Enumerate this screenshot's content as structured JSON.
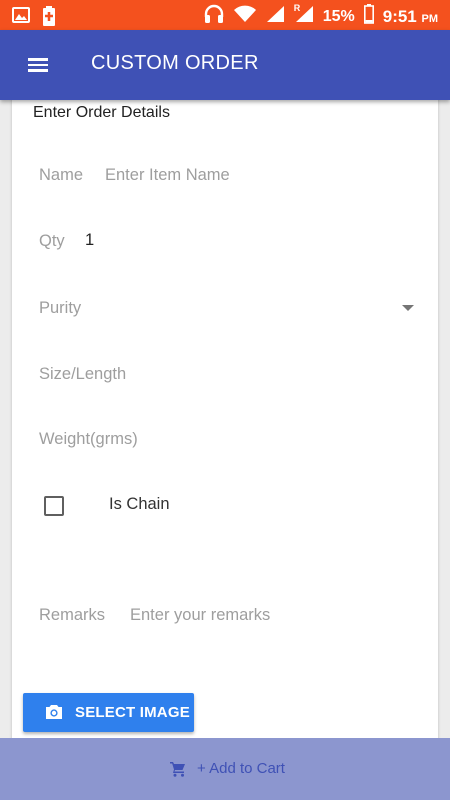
{
  "status_bar": {
    "battery": "15%",
    "time": "9:51",
    "ampm": "PM",
    "network_badge": "R"
  },
  "app_bar": {
    "title": "CUSTOM ORDER"
  },
  "form": {
    "section_title": "Enter Order Details",
    "name_label": "Name",
    "name_placeholder": "Enter Item Name",
    "qty_label": "Qty",
    "qty_value": "1",
    "purity_label": "Purity",
    "size_label": "Size/Length",
    "weight_label": "Weight(grms)",
    "is_chain_label": "Is Chain",
    "is_chain_checked": false,
    "remarks_label": "Remarks",
    "remarks_placeholder": "Enter your remarks"
  },
  "actions": {
    "select_image_label": "SELECT IMAGE",
    "add_to_cart_label": "+ Add to Cart"
  },
  "colors": {
    "status_bar": "#f4511e",
    "app_bar": "#3f51b5",
    "select_image_button": "#2f80ed",
    "bottom_bar": "#8c96cf"
  }
}
